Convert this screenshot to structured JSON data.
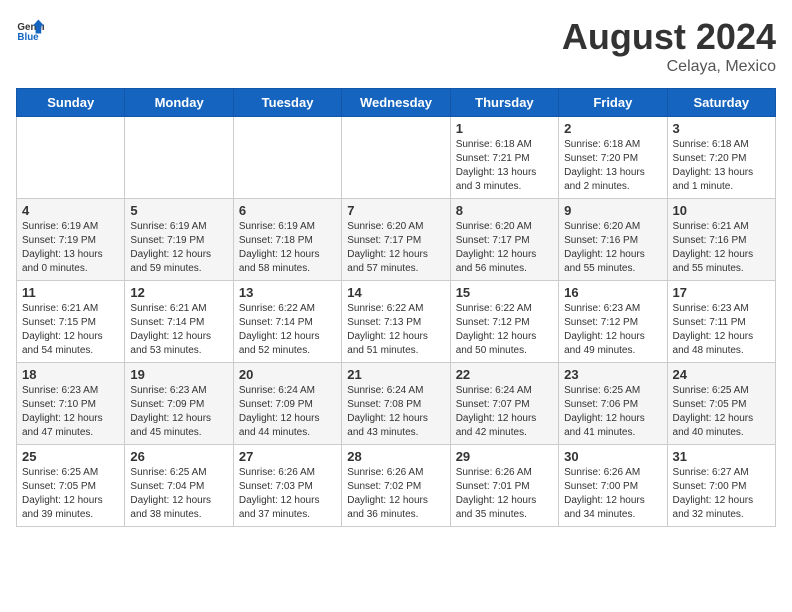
{
  "header": {
    "logo_general": "General",
    "logo_blue": "Blue",
    "month_title": "August 2024",
    "location": "Celaya, Mexico"
  },
  "weekdays": [
    "Sunday",
    "Monday",
    "Tuesday",
    "Wednesday",
    "Thursday",
    "Friday",
    "Saturday"
  ],
  "weeks": [
    [
      {
        "day": "",
        "info": ""
      },
      {
        "day": "",
        "info": ""
      },
      {
        "day": "",
        "info": ""
      },
      {
        "day": "",
        "info": ""
      },
      {
        "day": "1",
        "info": "Sunrise: 6:18 AM\nSunset: 7:21 PM\nDaylight: 13 hours\nand 3 minutes."
      },
      {
        "day": "2",
        "info": "Sunrise: 6:18 AM\nSunset: 7:20 PM\nDaylight: 13 hours\nand 2 minutes."
      },
      {
        "day": "3",
        "info": "Sunrise: 6:18 AM\nSunset: 7:20 PM\nDaylight: 13 hours\nand 1 minute."
      }
    ],
    [
      {
        "day": "4",
        "info": "Sunrise: 6:19 AM\nSunset: 7:19 PM\nDaylight: 13 hours\nand 0 minutes."
      },
      {
        "day": "5",
        "info": "Sunrise: 6:19 AM\nSunset: 7:19 PM\nDaylight: 12 hours\nand 59 minutes."
      },
      {
        "day": "6",
        "info": "Sunrise: 6:19 AM\nSunset: 7:18 PM\nDaylight: 12 hours\nand 58 minutes."
      },
      {
        "day": "7",
        "info": "Sunrise: 6:20 AM\nSunset: 7:17 PM\nDaylight: 12 hours\nand 57 minutes."
      },
      {
        "day": "8",
        "info": "Sunrise: 6:20 AM\nSunset: 7:17 PM\nDaylight: 12 hours\nand 56 minutes."
      },
      {
        "day": "9",
        "info": "Sunrise: 6:20 AM\nSunset: 7:16 PM\nDaylight: 12 hours\nand 55 minutes."
      },
      {
        "day": "10",
        "info": "Sunrise: 6:21 AM\nSunset: 7:16 PM\nDaylight: 12 hours\nand 55 minutes."
      }
    ],
    [
      {
        "day": "11",
        "info": "Sunrise: 6:21 AM\nSunset: 7:15 PM\nDaylight: 12 hours\nand 54 minutes."
      },
      {
        "day": "12",
        "info": "Sunrise: 6:21 AM\nSunset: 7:14 PM\nDaylight: 12 hours\nand 53 minutes."
      },
      {
        "day": "13",
        "info": "Sunrise: 6:22 AM\nSunset: 7:14 PM\nDaylight: 12 hours\nand 52 minutes."
      },
      {
        "day": "14",
        "info": "Sunrise: 6:22 AM\nSunset: 7:13 PM\nDaylight: 12 hours\nand 51 minutes."
      },
      {
        "day": "15",
        "info": "Sunrise: 6:22 AM\nSunset: 7:12 PM\nDaylight: 12 hours\nand 50 minutes."
      },
      {
        "day": "16",
        "info": "Sunrise: 6:23 AM\nSunset: 7:12 PM\nDaylight: 12 hours\nand 49 minutes."
      },
      {
        "day": "17",
        "info": "Sunrise: 6:23 AM\nSunset: 7:11 PM\nDaylight: 12 hours\nand 48 minutes."
      }
    ],
    [
      {
        "day": "18",
        "info": "Sunrise: 6:23 AM\nSunset: 7:10 PM\nDaylight: 12 hours\nand 47 minutes."
      },
      {
        "day": "19",
        "info": "Sunrise: 6:23 AM\nSunset: 7:09 PM\nDaylight: 12 hours\nand 45 minutes."
      },
      {
        "day": "20",
        "info": "Sunrise: 6:24 AM\nSunset: 7:09 PM\nDaylight: 12 hours\nand 44 minutes."
      },
      {
        "day": "21",
        "info": "Sunrise: 6:24 AM\nSunset: 7:08 PM\nDaylight: 12 hours\nand 43 minutes."
      },
      {
        "day": "22",
        "info": "Sunrise: 6:24 AM\nSunset: 7:07 PM\nDaylight: 12 hours\nand 42 minutes."
      },
      {
        "day": "23",
        "info": "Sunrise: 6:25 AM\nSunset: 7:06 PM\nDaylight: 12 hours\nand 41 minutes."
      },
      {
        "day": "24",
        "info": "Sunrise: 6:25 AM\nSunset: 7:05 PM\nDaylight: 12 hours\nand 40 minutes."
      }
    ],
    [
      {
        "day": "25",
        "info": "Sunrise: 6:25 AM\nSunset: 7:05 PM\nDaylight: 12 hours\nand 39 minutes."
      },
      {
        "day": "26",
        "info": "Sunrise: 6:25 AM\nSunset: 7:04 PM\nDaylight: 12 hours\nand 38 minutes."
      },
      {
        "day": "27",
        "info": "Sunrise: 6:26 AM\nSunset: 7:03 PM\nDaylight: 12 hours\nand 37 minutes."
      },
      {
        "day": "28",
        "info": "Sunrise: 6:26 AM\nSunset: 7:02 PM\nDaylight: 12 hours\nand 36 minutes."
      },
      {
        "day": "29",
        "info": "Sunrise: 6:26 AM\nSunset: 7:01 PM\nDaylight: 12 hours\nand 35 minutes."
      },
      {
        "day": "30",
        "info": "Sunrise: 6:26 AM\nSunset: 7:00 PM\nDaylight: 12 hours\nand 34 minutes."
      },
      {
        "day": "31",
        "info": "Sunrise: 6:27 AM\nSunset: 7:00 PM\nDaylight: 12 hours\nand 32 minutes."
      }
    ]
  ]
}
